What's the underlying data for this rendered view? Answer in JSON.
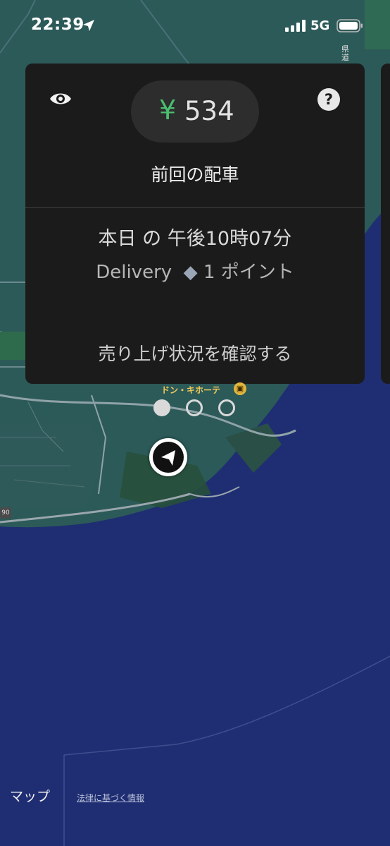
{
  "status_bar": {
    "time": "22:39",
    "network": "5G",
    "icons": [
      "location-arrow-icon",
      "signal-icon",
      "battery-icon"
    ]
  },
  "card": {
    "amount_currency": "¥",
    "amount_value": "534",
    "section_title": "前回の配車",
    "trip_time": "本日 の 午後10時07分",
    "trip_type": "Delivery",
    "trip_points": "1 ポイント",
    "earnings_link": "売り上げ状況を確認する",
    "icons": [
      "eye-icon",
      "help-icon"
    ],
    "help_glyph": "?"
  },
  "pager": {
    "count": 3,
    "active_index": 0
  },
  "map": {
    "store_label": "ドン・キホーテ",
    "road_label": "県道",
    "route_number": "90",
    "apple_maps_label": "マップ",
    "legal_link": "法律に基づく情報"
  },
  "colors": {
    "sea": "#1f2e72",
    "land": "#2c5a58",
    "card_bg": "#1b1b1b",
    "accent_green": "#4bbf6f"
  }
}
